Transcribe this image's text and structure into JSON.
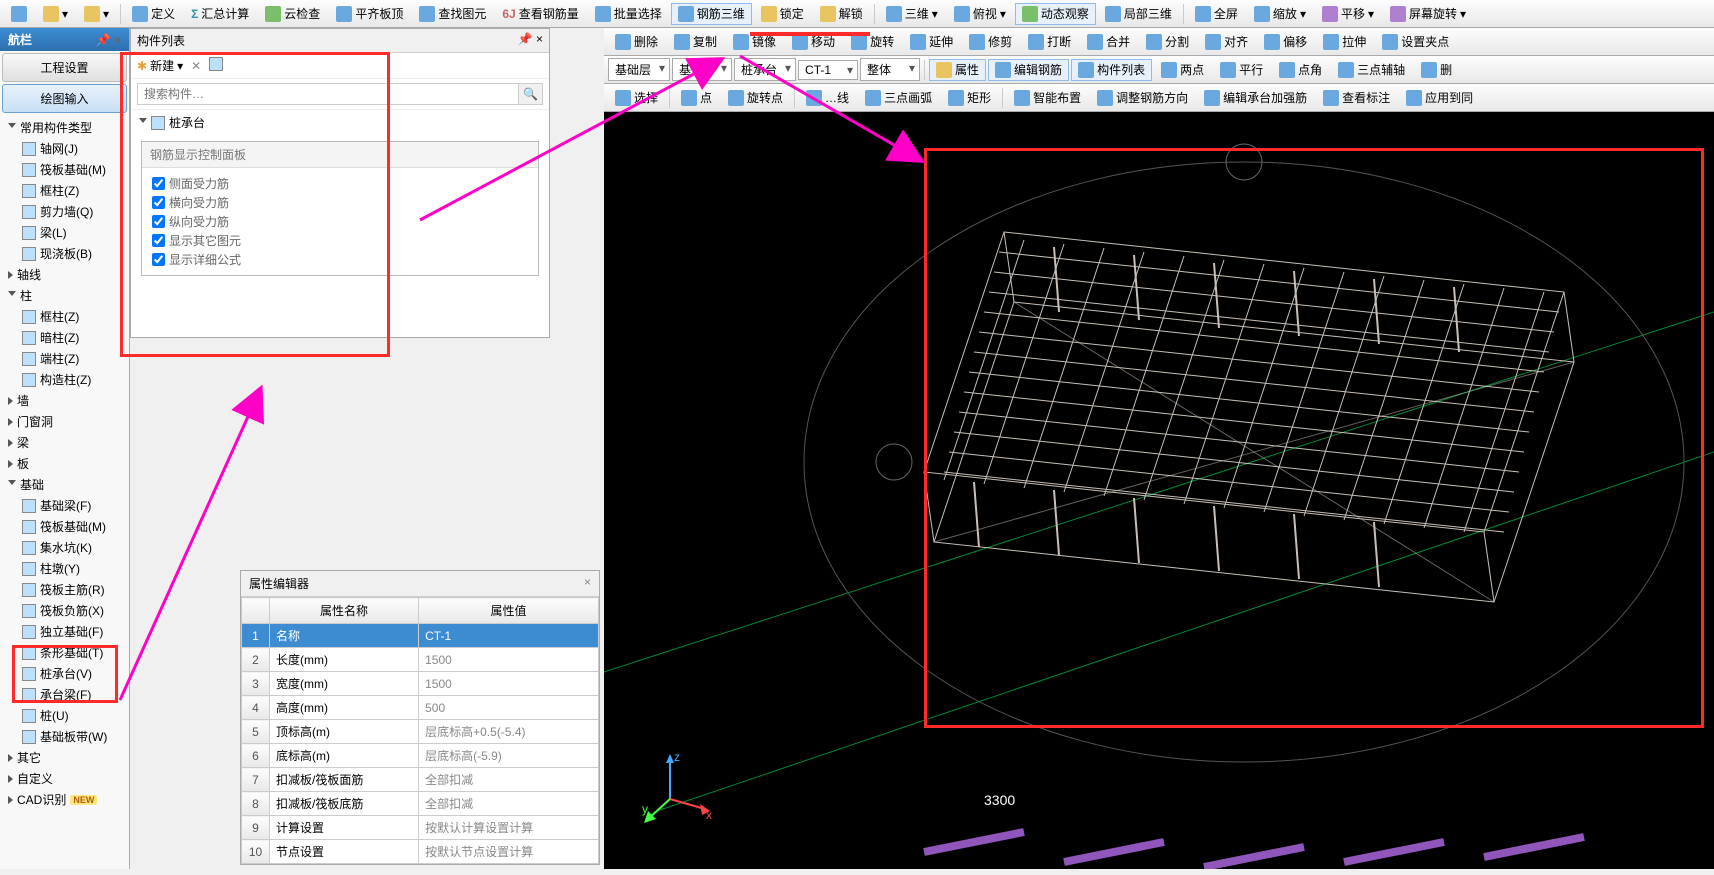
{
  "toolbar_top": [
    "定义",
    "汇总计算",
    "云检查",
    "平齐板顶",
    "查找图元",
    "查看钢筋量",
    "批量选择",
    "钢筋三维",
    "锁定",
    "解锁",
    "",
    "三维",
    "俯视",
    "动态观察",
    "局部三维",
    "全屏",
    "缩放",
    "平移",
    "屏幕旋转"
  ],
  "nav": {
    "title": "航栏",
    "btn_project": "工程设置",
    "btn_draw": "绘图输入",
    "groups": [
      {
        "label": "常用构件类型",
        "items": [
          "轴网(J)",
          "筏板基础(M)",
          "框柱(Z)",
          "剪力墙(Q)",
          "梁(L)",
          "现浇板(B)"
        ]
      },
      {
        "label": "轴线",
        "items": []
      },
      {
        "label": "柱",
        "items": [
          "框柱(Z)",
          "暗柱(Z)",
          "端柱(Z)",
          "构造柱(Z)"
        ]
      },
      {
        "label": "墙",
        "items": []
      },
      {
        "label": "门窗洞",
        "items": []
      },
      {
        "label": "梁",
        "items": []
      },
      {
        "label": "板",
        "items": []
      },
      {
        "label": "基础",
        "items": [
          "基础梁(F)",
          "筏板基础(M)",
          "集水坑(K)",
          "柱墩(Y)",
          "筏板主筋(R)",
          "筏板负筋(X)",
          "独立基础(F)",
          "条形基础(T)",
          "桩承台(V)",
          "承台梁(F)",
          "桩(U)",
          "基础板带(W)"
        ]
      },
      {
        "label": "其它",
        "items": []
      },
      {
        "label": "自定义",
        "items": []
      },
      {
        "label": "CAD识别",
        "items": [],
        "new": true
      }
    ]
  },
  "complist": {
    "title": "构件列表",
    "new": "新建",
    "search_ph": "搜索构件…",
    "root": "桩承台",
    "panel_title": "钢筋显示控制面板",
    "checks": [
      "侧面受力筋",
      "横向受力筋",
      "纵向受力筋",
      "显示其它图元",
      "显示详细公式"
    ]
  },
  "tb2": [
    "删除",
    "复制",
    "镜像",
    "移动",
    "旋转",
    "延伸",
    "修剪",
    "打断",
    "合并",
    "分割",
    "对齐",
    "偏移",
    "拉伸",
    "设置夹点"
  ],
  "tb3_dd": [
    "基础层",
    "基…",
    "桩承台",
    "CT-1",
    "整体"
  ],
  "tb3_btn": [
    "属性",
    "编辑钢筋",
    "构件列表",
    "两点",
    "平行",
    "点角",
    "三点辅轴",
    "删"
  ],
  "tb4": [
    "选择",
    "点",
    "旋转点",
    "…线",
    "三点画弧",
    "矩形",
    "智能布置",
    "调整钢筋方向",
    "编辑承台加强筋",
    "查看标注",
    "应用到同"
  ],
  "prop": {
    "title": "属性编辑器",
    "h1": "属性名称",
    "h2": "属性值",
    "rows": [
      {
        "n": "名称",
        "v": "CT-1"
      },
      {
        "n": "长度(mm)",
        "v": "1500"
      },
      {
        "n": "宽度(mm)",
        "v": "1500"
      },
      {
        "n": "高度(mm)",
        "v": "500"
      },
      {
        "n": "顶标高(m)",
        "v": "层底标高+0.5(-5.4)"
      },
      {
        "n": "底标高(m)",
        "v": "层底标高(-5.9)"
      },
      {
        "n": "扣减板/筏板面筋",
        "v": "全部扣减"
      },
      {
        "n": "扣减板/筏板底筋",
        "v": "全部扣减"
      },
      {
        "n": "计算设置",
        "v": "按默认计算设置计算"
      },
      {
        "n": "节点设置",
        "v": "按默认节点设置计算"
      }
    ]
  },
  "dim": "3300",
  "axis": {
    "x": "x",
    "y": "y",
    "z": "z"
  }
}
